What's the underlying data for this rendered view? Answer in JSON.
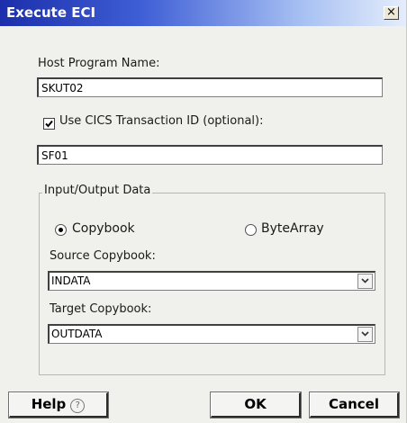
{
  "dialog": {
    "title": "Execute ECI",
    "close_glyph": "×"
  },
  "host_program": {
    "label": "Host Program Name:",
    "value": "SKUT02"
  },
  "cics": {
    "checked": true,
    "label": "Use CICS Transaction ID (optional):",
    "value": "SF01"
  },
  "io_group": {
    "legend": "Input/Output Data",
    "options": [
      {
        "label": "Copybook",
        "selected": true
      },
      {
        "label": "ByteArray",
        "selected": false
      }
    ],
    "source_label": "Source Copybook:",
    "source_value": "INDATA",
    "target_label": "Target Copybook:",
    "target_value": "OUTDATA"
  },
  "buttons": {
    "help": "Help",
    "help_icon": "?",
    "ok": "OK",
    "cancel": "Cancel"
  }
}
